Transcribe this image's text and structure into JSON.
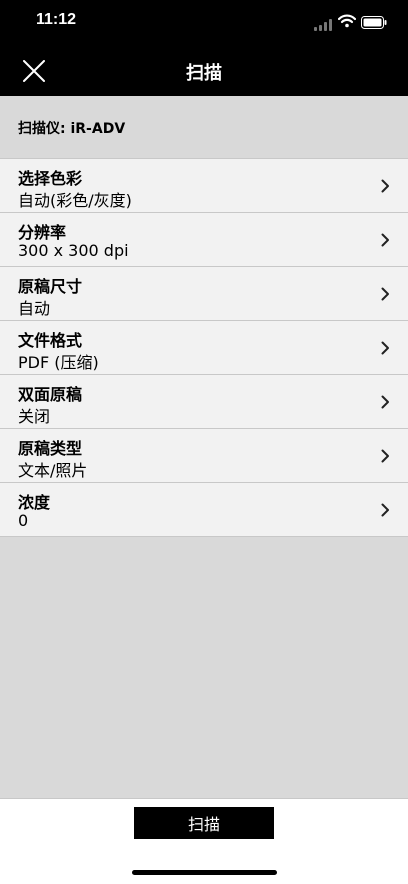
{
  "status_bar": {
    "time": "11:12"
  },
  "nav": {
    "title": "扫描",
    "close_icon": "close-icon"
  },
  "scanner": {
    "label": "扫描仪: iR-ADV"
  },
  "settings": [
    {
      "title": "选择色彩",
      "value": "自动(彩色/灰度)"
    },
    {
      "title": "分辨率",
      "value": "300 x 300 dpi"
    },
    {
      "title": "原稿尺寸",
      "value": "自动"
    },
    {
      "title": "文件格式",
      "value": "PDF (压缩)"
    },
    {
      "title": "双面原稿",
      "value": "关闭"
    },
    {
      "title": "原稿类型",
      "value": "文本/照片"
    },
    {
      "title": "浓度",
      "value": "0"
    }
  ],
  "footer": {
    "scan_label": "扫描"
  },
  "colors": {
    "bar_background": "#000000",
    "page_background": "#d9d9d9",
    "row_background": "#f2f2f2",
    "divider": "#c8c8c8",
    "button_background": "#000000",
    "button_text": "#ffffff"
  }
}
